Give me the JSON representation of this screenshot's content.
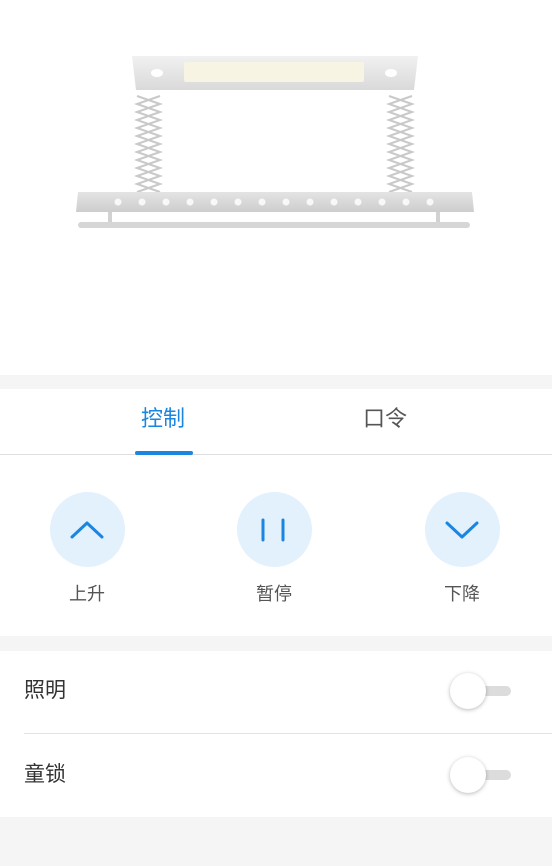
{
  "tabs": {
    "control": "控制",
    "voice": "口令"
  },
  "controls": {
    "up": "上升",
    "pause": "暂停",
    "down": "下降"
  },
  "settings": {
    "lighting": {
      "label": "照明",
      "on": false
    },
    "child_lock": {
      "label": "童锁",
      "on": false
    }
  },
  "colors": {
    "accent": "#1a86e0",
    "button_bg": "#e3f1fd"
  }
}
